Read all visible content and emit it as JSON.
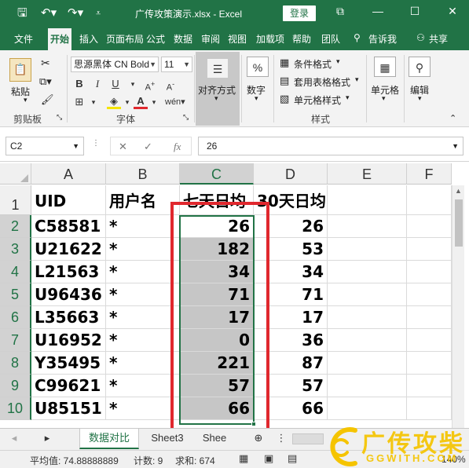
{
  "titlebar": {
    "title": "广传攻策演示.xlsx  -  Excel",
    "login": "登录",
    "restore_icon": "⧉",
    "minimize_icon": "—",
    "maximize_icon": "☐",
    "close_icon": "✕"
  },
  "tabs": [
    "文件",
    "开始",
    "插入",
    "页面布局",
    "公式",
    "数据",
    "审阅",
    "视图",
    "加载项",
    "帮助",
    "团队"
  ],
  "tell_me": "告诉我",
  "share": "共享",
  "ribbon": {
    "paste": "粘贴",
    "clipboard_label": "剪贴板",
    "font_name": "思源黑体 CN Bold",
    "font_size": "11",
    "font_label": "字体",
    "align": "对齐方式",
    "number": "数字",
    "cond_format": "条件格式",
    "table_format": "套用表格格式",
    "cell_style": "单元格样式",
    "styles_label": "样式",
    "cells": "单元格",
    "edit": "编辑"
  },
  "formula_bar": {
    "name_box": "C2",
    "fx": "fx",
    "value": "26"
  },
  "grid": {
    "columns": [
      "A",
      "B",
      "C",
      "D",
      "E",
      "F"
    ],
    "rows": [
      [
        "UID",
        "用户名",
        "七天日均",
        "30天日均"
      ],
      [
        "C58581",
        "*",
        "26",
        "26"
      ],
      [
        "U21622",
        "*",
        "182",
        "53"
      ],
      [
        "L21563",
        "*",
        "34",
        "34"
      ],
      [
        "U96436",
        "*",
        "71",
        "71"
      ],
      [
        "L35663",
        "*",
        "17",
        "17"
      ],
      [
        "U16952",
        "*",
        "0",
        "36"
      ],
      [
        "Y35495",
        "*",
        "221",
        "87"
      ],
      [
        "C99621",
        "*",
        "57",
        "57"
      ],
      [
        "U85151",
        "*",
        "66",
        "66"
      ]
    ],
    "row_numbers": [
      "1",
      "2",
      "3",
      "4",
      "5",
      "6",
      "7",
      "8",
      "9",
      "10"
    ]
  },
  "sheets": [
    "数据对比",
    "Sheet3",
    "Shee"
  ],
  "statusbar": {
    "average": "平均值: 74.88888889",
    "count": "计数: 9",
    "sum": "求和: 674",
    "zoom": "140%"
  },
  "watermark": {
    "brand": "广传攻柴",
    "url": "GGWITH.COM"
  },
  "colors": {
    "excel_green": "#217346",
    "highlight_red": "#e0282e",
    "selection_gray": "#c6c6c6",
    "watermark_yellow": "#f5c400"
  }
}
